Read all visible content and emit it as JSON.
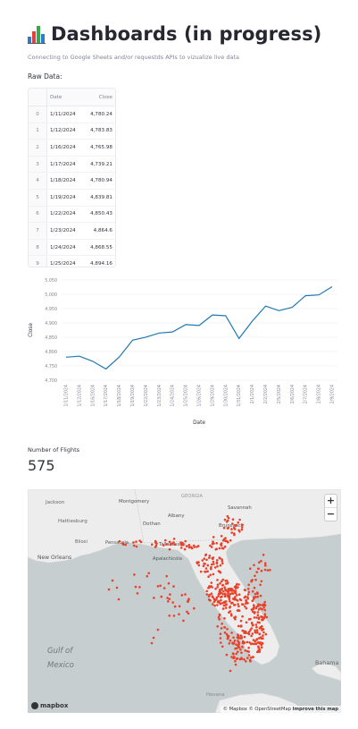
{
  "header": {
    "title": "Dashboards (in progress)",
    "subtitle": "Connecting to Google Sheets and/or requestds APIs to vizualize live data",
    "icon": "bar-chart-icon"
  },
  "raw_data": {
    "label": "Raw Data:",
    "columns": [
      "",
      "Date",
      "Close"
    ],
    "rows": [
      [
        "0",
        "1/11/2024",
        "4,780.24"
      ],
      [
        "1",
        "1/12/2024",
        "4,783.83"
      ],
      [
        "2",
        "1/16/2024",
        "4,765.98"
      ],
      [
        "3",
        "1/17/2024",
        "4,739.21"
      ],
      [
        "4",
        "1/18/2024",
        "4,780.94"
      ],
      [
        "5",
        "1/19/2024",
        "4,839.81"
      ],
      [
        "6",
        "1/22/2024",
        "4,850.43"
      ],
      [
        "7",
        "1/23/2024",
        "4,864.6"
      ],
      [
        "8",
        "1/24/2024",
        "4,868.55"
      ],
      [
        "9",
        "1/25/2024",
        "4,894.16"
      ]
    ]
  },
  "chart_data": {
    "type": "line",
    "xlabel": "Date",
    "ylabel": "Close",
    "ylim": [
      4700,
      5050
    ],
    "yticks": [
      "4,700",
      "4,750",
      "4,800",
      "4,850",
      "4,900",
      "4,950",
      "5,000",
      "5,050"
    ],
    "color": "#1f77b4",
    "grid": true,
    "x": [
      "1/11/2024",
      "1/12/2024",
      "1/16/2024",
      "1/17/2024",
      "1/18/2024",
      "1/19/2024",
      "1/22/2024",
      "1/23/2024",
      "1/24/2024",
      "1/25/2024",
      "1/26/2024",
      "1/29/2024",
      "1/30/2024",
      "1/31/2024",
      "2/1/2024",
      "2/2/2024",
      "2/5/2024",
      "2/6/2024",
      "2/7/2024",
      "2/8/2024",
      "2/9/2024"
    ],
    "values": [
      4780.24,
      4783.83,
      4765.98,
      4739.21,
      4780.94,
      4839.81,
      4850.43,
      4864.6,
      4868.55,
      4894.16,
      4890.97,
      4927.93,
      4924.97,
      4845.65,
      4906.19,
      4958.61,
      4942.81,
      4954.23,
      4995.06,
      4997.91,
      5026.61
    ]
  },
  "metric": {
    "label": "Number of Flights",
    "value": "575"
  },
  "map": {
    "zoom_in": "+",
    "zoom_out": "−",
    "logo": "mapbox",
    "attribution": "© Mapbox © OpenStreetMap",
    "improve": "Improve this map",
    "labels": {
      "georgia": "GEORGIA",
      "jackson": "Jackson",
      "montgomery": "Montgomery",
      "hattiesburg": "Hattiesburg",
      "dothan": "Dothan",
      "albany": "Albany",
      "savannah": "Savannah",
      "brunswick": "Brunswick",
      "biloxi": "Biloxi",
      "pensacola": "Pensacola",
      "new_orleans": "New Orleans",
      "tallahassee": "Tallahassee",
      "apalachicola": "Apalachicola",
      "gulf1": "Gulf of",
      "gulf2": "Mexico",
      "bahamas": "Bahama",
      "havana": "Havana"
    },
    "water_color": "#c7ced0",
    "land_color": "#eeeeee",
    "point_color": "#e8412a"
  }
}
